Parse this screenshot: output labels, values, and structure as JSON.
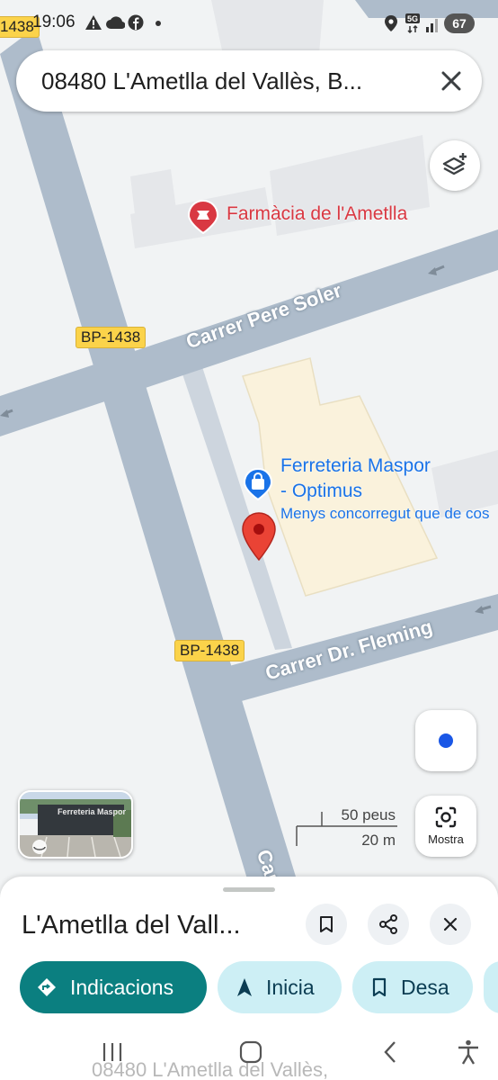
{
  "status_bar": {
    "time": "19:06",
    "battery": "67"
  },
  "search": {
    "query": "08480 L'Ametlla del Vallès, B..."
  },
  "map": {
    "road_badges": [
      "1438",
      "BP-1438",
      "BP-1438"
    ],
    "streets": [
      "Carrer Pere Soler",
      "Carrer Dr. Fleming",
      "Car"
    ],
    "poi_pharmacy": "Farmàcia de l'Ametlla",
    "poi_store_name_line1": "Ferreteria Maspor",
    "poi_store_name_line2": "- Optimus",
    "poi_store_sub": "Menys concorregut que de cos",
    "streetview_sign": "Ferreteria Maspor",
    "scale_imperial": "50 peus",
    "scale_metric": "20 m",
    "show_button_label": "Mostra"
  },
  "sheet": {
    "title": "L'Ametlla del Vall...",
    "buttons": {
      "directions": "Indicacions",
      "start": "Inicia",
      "save": "Desa"
    }
  },
  "ghost_text": "08480 L'Ametlla del Vallès,",
  "colors": {
    "accent": "#0b7f80",
    "chip": "#cdeff5",
    "pharmacy": "#d93842",
    "store": "#1a73e8",
    "pin": "#ea4335"
  },
  "icons": [
    "alert-icon",
    "cloud-icon",
    "facebook-icon",
    "location-icon",
    "signal-5g-icon",
    "close-icon",
    "layers-icon",
    "pharmacy-icon",
    "shopping-bag-icon",
    "map-pin-icon",
    "my-location-icon",
    "lens-icon",
    "bookmark-icon",
    "share-icon",
    "directions-icon",
    "navigation-icon",
    "recents-icon",
    "home-icon",
    "back-icon",
    "accessibility-icon"
  ]
}
